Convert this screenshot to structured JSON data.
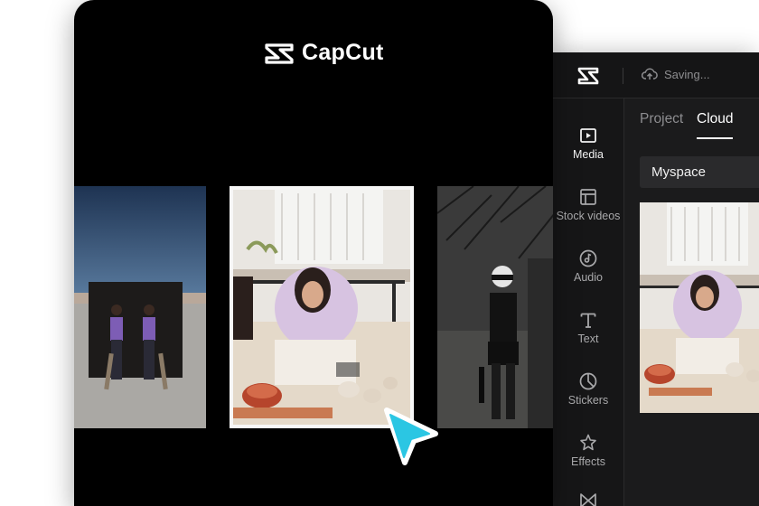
{
  "brand": {
    "name": "CapCut"
  },
  "editor": {
    "status": "Saving...",
    "nav": [
      {
        "label": "Media",
        "icon": "media-play-icon",
        "active": true
      },
      {
        "label": "Stock videos",
        "icon": "stock-videos-icon",
        "active": false
      },
      {
        "label": "Audio",
        "icon": "audio-note-icon",
        "active": false
      },
      {
        "label": "Text",
        "icon": "text-t-icon",
        "active": false
      },
      {
        "label": "Stickers",
        "icon": "stickers-icon",
        "active": false
      },
      {
        "label": "Effects",
        "icon": "effects-star-icon",
        "active": false
      },
      {
        "label": "",
        "icon": "transitions-bowtie-icon",
        "active": false
      }
    ],
    "tabs": [
      {
        "label": "Project",
        "active": false
      },
      {
        "label": "Cloud",
        "active": true
      }
    ],
    "folder": "Myspace"
  },
  "colors": {
    "cursor": "#2bc6e3",
    "bg_dark": "#1b1b1c",
    "accent_white": "#ffffff"
  }
}
